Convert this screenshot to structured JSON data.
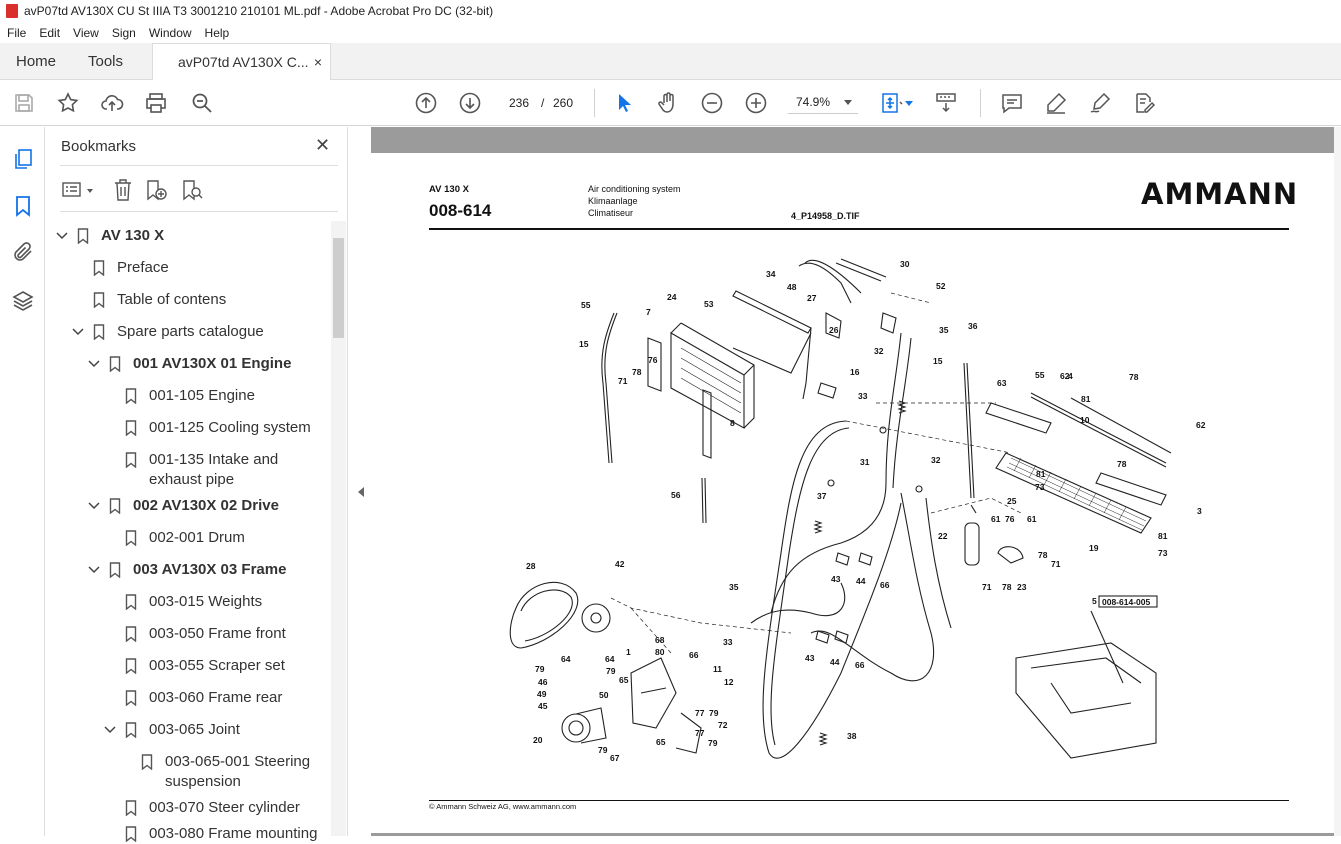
{
  "window": {
    "title": "avP07td AV130X CU St IIIA T3 3001210 210101 ML.pdf - Adobe Acrobat Pro DC (32-bit)"
  },
  "menu": [
    "File",
    "Edit",
    "View",
    "Sign",
    "Window",
    "Help"
  ],
  "tabs": {
    "home": "Home",
    "tools": "Tools",
    "document": "avP07td AV130X C...",
    "close": "×"
  },
  "toolbar": {
    "current_page": "236",
    "page_sep": "/",
    "total_pages": "260",
    "zoom": "74.9%"
  },
  "bookmarks": {
    "title": "Bookmarks",
    "close": "✕",
    "items": [
      {
        "label": "AV 130 X"
      },
      {
        "label": "Preface"
      },
      {
        "label": "Table of contens"
      },
      {
        "label": "Spare parts catalogue"
      },
      {
        "label": "001 AV130X 01 Engine"
      },
      {
        "label": "001-105 Engine"
      },
      {
        "label": "001-125 Cooling system"
      },
      {
        "label": "001-135 Intake and"
      },
      {
        "label": "exhaust pipe"
      },
      {
        "label": "002 AV130X 02 Drive"
      },
      {
        "label": "002-001 Drum"
      },
      {
        "label": "003 AV130X 03 Frame"
      },
      {
        "label": "003-015 Weights"
      },
      {
        "label": "003-050 Frame front"
      },
      {
        "label": "003-055 Scraper set"
      },
      {
        "label": "003-060 Frame rear"
      },
      {
        "label": "003-065 Joint"
      },
      {
        "label": "003-065-001 Steering"
      },
      {
        "label": "suspension"
      },
      {
        "label": "003-070 Steer cylinder"
      },
      {
        "label": "003-080 Frame mounting"
      }
    ]
  },
  "document": {
    "model": "AV 130 X",
    "code": "008-614",
    "title_en": "Air conditioning system",
    "title_de": "Klimaanlage",
    "title_fr": "Climatiseur",
    "file": "4_P14958_D.TIF",
    "brand": "AMMANN",
    "footer": "© Ammann Schweiz AG, www.ammann.com",
    "ref_box": "008-614-005",
    "callouts": [
      "30",
      "34",
      "48",
      "27",
      "52",
      "55",
      "24",
      "53",
      "7",
      "26",
      "35",
      "15",
      "32",
      "76",
      "78",
      "71",
      "8",
      "16",
      "33",
      "36",
      "55",
      "62",
      "78",
      "63",
      "4",
      "81",
      "10",
      "62",
      "15",
      "31",
      "32",
      "81",
      "73",
      "25",
      "3",
      "78",
      "56",
      "37",
      "61",
      "76",
      "61",
      "22",
      "19",
      "81",
      "73",
      "43",
      "44",
      "66",
      "71",
      "78",
      "71",
      "23",
      "78",
      "28",
      "42",
      "35",
      "5",
      "33",
      "43",
      "44",
      "66",
      "68",
      "80",
      "66",
      "64",
      "79",
      "64",
      "1",
      "79",
      "46",
      "50",
      "49",
      "65",
      "45",
      "11",
      "12",
      "77",
      "79",
      "20",
      "77",
      "79",
      "72",
      "38",
      "79",
      "65",
      "67"
    ]
  },
  "colors": {
    "accent_blue": "#1473e6",
    "doc_bg": "#9b9b9b"
  }
}
